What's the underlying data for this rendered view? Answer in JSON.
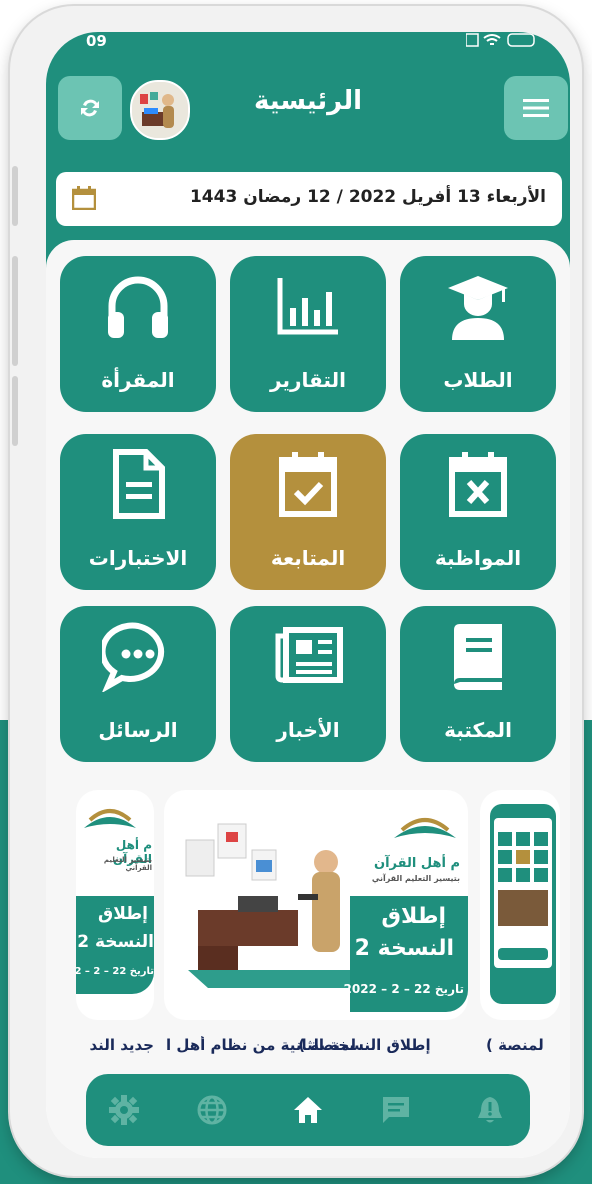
{
  "status_bar": {
    "time": "09",
    "battery": ""
  },
  "header": {
    "title": "الرئيسية",
    "menu_icon": "menu-icon",
    "sync_icon": "sync-icon"
  },
  "date_bar": {
    "text": "الأربعاء 13 أفريل 2022 / 12 رمضان 1443",
    "icon": "calendar-icon"
  },
  "tiles": [
    {
      "label": "الطلاب",
      "icon": "student-icon"
    },
    {
      "label": "التقارير",
      "icon": "chart-icon"
    },
    {
      "label": "المقرأة",
      "icon": "headphones-icon"
    },
    {
      "label": "المواظبة",
      "icon": "calendar-x-icon"
    },
    {
      "label": "المتابعة",
      "icon": "calendar-check-icon",
      "active": true
    },
    {
      "label": "الاختبارات",
      "icon": "document-icon"
    },
    {
      "label": "المكتبة",
      "icon": "book-icon"
    },
    {
      "label": "الأخبار",
      "icon": "newspaper-icon"
    },
    {
      "label": "الرسائل",
      "icon": "chat-icon"
    }
  ],
  "banners": {
    "main": {
      "brand": "م أهل القرآن",
      "brand_sub": "بتيسير التعليم القرآني",
      "headline1": "إطلاق",
      "headline2": "النسخة 2",
      "date": "تاريخ 22 – 2 – 2022",
      "caption": "إطلاق النسخة الثانية من نظام أهل ا"
    },
    "left": {
      "brand": "م أهل القرآن",
      "brand_sub": "بتيسير التعليم القرآني",
      "headline1": "إطلاق",
      "headline2": "النسخة 2",
      "date": "تاريخ 22 – 2 – 2",
      "caption": "جديد الند"
    },
    "right": {
      "caption": "لمنصة )"
    }
  },
  "nav": [
    {
      "name": "settings",
      "icon": "gear-icon"
    },
    {
      "name": "web",
      "icon": "globe-icon"
    },
    {
      "name": "home",
      "icon": "home-icon"
    },
    {
      "name": "messages",
      "icon": "message-icon"
    },
    {
      "name": "notifications",
      "icon": "bell-icon"
    }
  ],
  "colors": {
    "primary": "#1f8f7d",
    "accent": "#b4903d",
    "light": "#6cc4b3"
  }
}
